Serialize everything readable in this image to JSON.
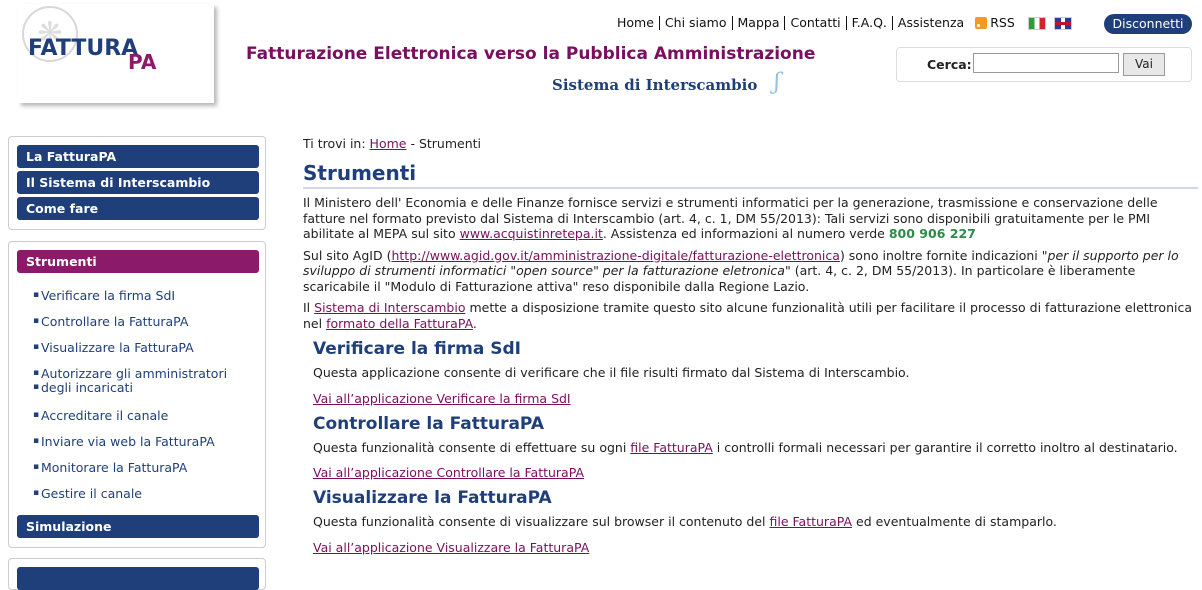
{
  "header": {
    "logo_main": "FATTURA",
    "logo_pa": "PA",
    "title": "Fatturazione Elettronica verso la Pubblica Amministrazione",
    "subtitle": "Sistema di Interscambio",
    "nav": [
      "Home",
      "Chi siamo",
      "Mappa",
      "Contatti",
      "F.A.Q.",
      "Assistenza"
    ],
    "rss": "RSS",
    "disconnect": "Disconnetti",
    "search_label": "Cerca:",
    "search_value": "",
    "search_button": "Vai"
  },
  "sidebar": {
    "top_items": [
      "La FatturaPA",
      "Il Sistema di Interscambio",
      "Come fare"
    ],
    "section_title": "Strumenti",
    "sub_items": [
      "Verificare la firma SdI",
      "Controllare la FatturaPA",
      "Visualizzare la FatturaPA",
      "Autorizzare gli amministratori",
      "degli incaricati",
      "Accreditare il canale",
      "Inviare via web la FatturaPA",
      "Monitorare la FatturaPA",
      "Gestire il canale"
    ],
    "simulation": "Simulazione"
  },
  "main": {
    "breadcrumb_prefix": "Ti trovi in:",
    "breadcrumb_home": "Home",
    "breadcrumb_sep": "-",
    "breadcrumb_current": "Strumenti",
    "title": "Strumenti",
    "p1_a": "Il Ministero dell' Economia e delle Finanze fornisce servizi e strumenti informatici per la generazione, trasmissione e conservazione delle fatture nel formato previsto dal Sistema di Interscambio (art. 4, c. 1, DM 55/2013): Tali servizi sono disponibili gratuitamente per le PMI abilitate al MEPA sul sito",
    "p1_link": "www.acquistinretepa.it",
    "p1_b": ". Assistenza ed informazioni al numero verde",
    "p1_phone": "800 906 227",
    "p2_a": "Sul sito AgID (",
    "p2_link": "http://www.agid.gov.it/amministrazione-digitale/fatturazione-elettronica",
    "p2_b": ") sono inoltre fornite indicazioni",
    "p2_quote": "\"per il supporto per lo sviluppo di strumenti informatici \"open source\" per la fatturazione eletronica\"",
    "p2_c": "(art. 4, c. 2, DM 55/2013). In particolare è liberamente scaricabile il \"Modulo di Fatturazione attiva\" reso disponibile dalla Regione Lazio.",
    "p3_a": "Il",
    "p3_link1": "Sistema di Interscambio",
    "p3_b": "mette a disposizione tramite questo sito alcune funzionalità utili per facilitare il processo di fatturazione elettronica nel",
    "p3_link2": "formato della FatturaPA",
    "p3_c": ".",
    "s1_title": "Verificare la firma SdI",
    "s1_text": "Questa applicazione consente di verificare che il file risulti firmato dal Sistema di Interscambio.",
    "s1_link": "Vai all’applicazione Verificare la firma SdI",
    "s2_title": "Controllare la FatturaPA",
    "s2_text_a": "Questa funzionalità consente di effettuare su ogni",
    "s2_text_link": "file FatturaPA",
    "s2_text_b": "i controlli formali necessari per garantire il corretto inoltro al destinatario.",
    "s2_link": "Vai all’applicazione Controllare la FatturaPA",
    "s3_title": "Visualizzare la FatturaPA",
    "s3_text_a": "Questa funzionalità consente di visualizzare sul browser il contenuto del",
    "s3_text_link": "file FatturaPA",
    "s3_text_b": "ed eventualmente di stamparlo.",
    "s3_link": "Vai all’applicazione Visualizzare la FatturaPA"
  }
}
